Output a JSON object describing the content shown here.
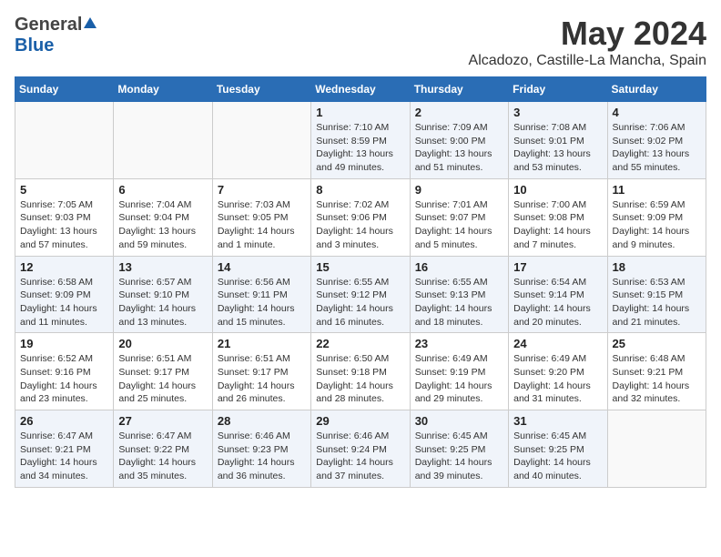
{
  "header": {
    "logo_general": "General",
    "logo_blue": "Blue",
    "month_title": "May 2024",
    "location": "Alcadozo, Castille-La Mancha, Spain"
  },
  "calendar": {
    "weekdays": [
      "Sunday",
      "Monday",
      "Tuesday",
      "Wednesday",
      "Thursday",
      "Friday",
      "Saturday"
    ],
    "weeks": [
      [
        {
          "day": "",
          "info": ""
        },
        {
          "day": "",
          "info": ""
        },
        {
          "day": "",
          "info": ""
        },
        {
          "day": "1",
          "info": "Sunrise: 7:10 AM\nSunset: 8:59 PM\nDaylight: 13 hours\nand 49 minutes."
        },
        {
          "day": "2",
          "info": "Sunrise: 7:09 AM\nSunset: 9:00 PM\nDaylight: 13 hours\nand 51 minutes."
        },
        {
          "day": "3",
          "info": "Sunrise: 7:08 AM\nSunset: 9:01 PM\nDaylight: 13 hours\nand 53 minutes."
        },
        {
          "day": "4",
          "info": "Sunrise: 7:06 AM\nSunset: 9:02 PM\nDaylight: 13 hours\nand 55 minutes."
        }
      ],
      [
        {
          "day": "5",
          "info": "Sunrise: 7:05 AM\nSunset: 9:03 PM\nDaylight: 13 hours\nand 57 minutes."
        },
        {
          "day": "6",
          "info": "Sunrise: 7:04 AM\nSunset: 9:04 PM\nDaylight: 13 hours\nand 59 minutes."
        },
        {
          "day": "7",
          "info": "Sunrise: 7:03 AM\nSunset: 9:05 PM\nDaylight: 14 hours\nand 1 minute."
        },
        {
          "day": "8",
          "info": "Sunrise: 7:02 AM\nSunset: 9:06 PM\nDaylight: 14 hours\nand 3 minutes."
        },
        {
          "day": "9",
          "info": "Sunrise: 7:01 AM\nSunset: 9:07 PM\nDaylight: 14 hours\nand 5 minutes."
        },
        {
          "day": "10",
          "info": "Sunrise: 7:00 AM\nSunset: 9:08 PM\nDaylight: 14 hours\nand 7 minutes."
        },
        {
          "day": "11",
          "info": "Sunrise: 6:59 AM\nSunset: 9:09 PM\nDaylight: 14 hours\nand 9 minutes."
        }
      ],
      [
        {
          "day": "12",
          "info": "Sunrise: 6:58 AM\nSunset: 9:09 PM\nDaylight: 14 hours\nand 11 minutes."
        },
        {
          "day": "13",
          "info": "Sunrise: 6:57 AM\nSunset: 9:10 PM\nDaylight: 14 hours\nand 13 minutes."
        },
        {
          "day": "14",
          "info": "Sunrise: 6:56 AM\nSunset: 9:11 PM\nDaylight: 14 hours\nand 15 minutes."
        },
        {
          "day": "15",
          "info": "Sunrise: 6:55 AM\nSunset: 9:12 PM\nDaylight: 14 hours\nand 16 minutes."
        },
        {
          "day": "16",
          "info": "Sunrise: 6:55 AM\nSunset: 9:13 PM\nDaylight: 14 hours\nand 18 minutes."
        },
        {
          "day": "17",
          "info": "Sunrise: 6:54 AM\nSunset: 9:14 PM\nDaylight: 14 hours\nand 20 minutes."
        },
        {
          "day": "18",
          "info": "Sunrise: 6:53 AM\nSunset: 9:15 PM\nDaylight: 14 hours\nand 21 minutes."
        }
      ],
      [
        {
          "day": "19",
          "info": "Sunrise: 6:52 AM\nSunset: 9:16 PM\nDaylight: 14 hours\nand 23 minutes."
        },
        {
          "day": "20",
          "info": "Sunrise: 6:51 AM\nSunset: 9:17 PM\nDaylight: 14 hours\nand 25 minutes."
        },
        {
          "day": "21",
          "info": "Sunrise: 6:51 AM\nSunset: 9:17 PM\nDaylight: 14 hours\nand 26 minutes."
        },
        {
          "day": "22",
          "info": "Sunrise: 6:50 AM\nSunset: 9:18 PM\nDaylight: 14 hours\nand 28 minutes."
        },
        {
          "day": "23",
          "info": "Sunrise: 6:49 AM\nSunset: 9:19 PM\nDaylight: 14 hours\nand 29 minutes."
        },
        {
          "day": "24",
          "info": "Sunrise: 6:49 AM\nSunset: 9:20 PM\nDaylight: 14 hours\nand 31 minutes."
        },
        {
          "day": "25",
          "info": "Sunrise: 6:48 AM\nSunset: 9:21 PM\nDaylight: 14 hours\nand 32 minutes."
        }
      ],
      [
        {
          "day": "26",
          "info": "Sunrise: 6:47 AM\nSunset: 9:21 PM\nDaylight: 14 hours\nand 34 minutes."
        },
        {
          "day": "27",
          "info": "Sunrise: 6:47 AM\nSunset: 9:22 PM\nDaylight: 14 hours\nand 35 minutes."
        },
        {
          "day": "28",
          "info": "Sunrise: 6:46 AM\nSunset: 9:23 PM\nDaylight: 14 hours\nand 36 minutes."
        },
        {
          "day": "29",
          "info": "Sunrise: 6:46 AM\nSunset: 9:24 PM\nDaylight: 14 hours\nand 37 minutes."
        },
        {
          "day": "30",
          "info": "Sunrise: 6:45 AM\nSunset: 9:25 PM\nDaylight: 14 hours\nand 39 minutes."
        },
        {
          "day": "31",
          "info": "Sunrise: 6:45 AM\nSunset: 9:25 PM\nDaylight: 14 hours\nand 40 minutes."
        },
        {
          "day": "",
          "info": ""
        }
      ]
    ]
  }
}
